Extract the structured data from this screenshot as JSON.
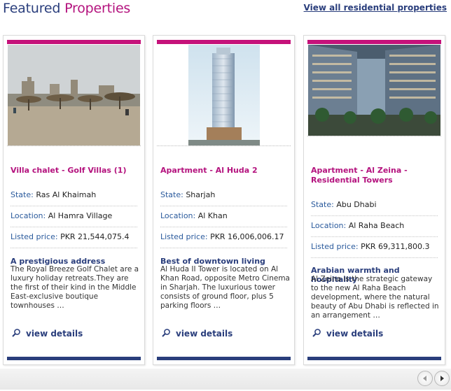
{
  "header": {
    "title_part1": "Featured ",
    "title_part2": "Properties",
    "view_all_label": "View all residential properties"
  },
  "labels": {
    "state": "State: ",
    "location": "Location: ",
    "price": "Listed price: ",
    "view_details": "view details"
  },
  "cards": [
    {
      "name": "Villa chalet - Golf Villas (1)",
      "state": "Ras Al Khaimah",
      "location": "Al Hamra Village",
      "price": "PKR 21,544,075.4",
      "desc_title": "A prestigious address",
      "desc": "The Royal Breeze Golf Chalet are a luxury holiday retreats.They are the first of their kind in the Middle East-exclusive boutique townhouses …"
    },
    {
      "name": "Apartment - Al Huda 2",
      "state": "Sharjah",
      "location": "Al Khan",
      "price": "PKR 16,006,006.17",
      "desc_title": "Best of downtown living",
      "desc": "Al Huda II Tower is located on Al Khan Road, opposite Metro Cinema in Sharjah. The luxurious tower consists of ground floor, plus 5 parking floors …"
    },
    {
      "name": "Apartment - Al Zeina - Residential Towers",
      "state": "Abu Dhabi",
      "location": "Al Raha Beach",
      "price": "PKR 69,311,800.3",
      "desc_title": "Arabian warmth and hospitality",
      "desc": "Al Zeina is the strategic gateway to the new Al Raha Beach development, where the natural beauty of Abu Dhabi is reflected in an arrangement …"
    }
  ],
  "colors": {
    "accent_magenta": "#b4137e",
    "navy": "#2a3e7c"
  },
  "icons": {
    "view_details": "magnifier-icon",
    "prev": "left-arrow-icon",
    "next": "right-arrow-icon"
  }
}
